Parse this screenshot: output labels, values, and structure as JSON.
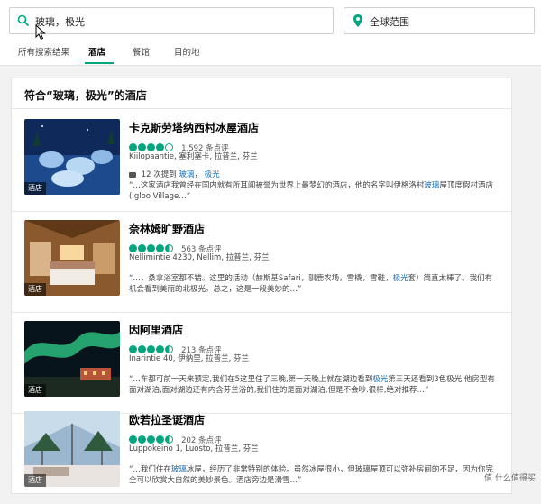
{
  "search": {
    "query": "玻璃，极光"
  },
  "location": {
    "value": "全球范围"
  },
  "tabs": [
    {
      "label": "所有搜索结果"
    },
    {
      "label": "酒店"
    },
    {
      "label": "餐馆"
    },
    {
      "label": "目的地"
    }
  ],
  "panel": {
    "title": "符合“玻璃，极光”的酒店"
  },
  "hotels": [
    {
      "name": "卡克斯劳塔纳西村冰屋酒店",
      "rating": 4.0,
      "reviews": "1,592 条点评",
      "address": "Kiilopaantie, 塞利塞卡, 拉普兰, 芬兰",
      "tag": "酒店",
      "mention_prefix": "12 次提到",
      "mention_kw1": "玻璃",
      "mention_sep": "，",
      "mention_kw2": "极光",
      "snippet_a": "“…这家酒店我曾经在国内就有所耳闻被誉为世界上最梦幻的酒店，他的名字叫伊格洛村",
      "snippet_hl": "玻璃",
      "snippet_b": "屋顶度假村酒店(Igloo Village…”"
    },
    {
      "name": "奈林姆旷野酒店",
      "rating": 4.5,
      "reviews": "563 条点评",
      "address": "Nellimintie 4230, Nellim, 拉普兰, 芬兰",
      "tag": "酒店",
      "snippet_a": "“…，桑拿浴室都不错。这里的活动（赫斯基Safari，驯鹿农场，雪橇，雪鞋，",
      "snippet_hl": "极光",
      "snippet_b": "套）简直太棒了。我们有机会看到美丽的北极光。总之，这是一段美妙的…”"
    },
    {
      "name": "因阿里酒店",
      "rating": 4.5,
      "reviews": "213 条点评",
      "address": "Inarintie 40, 伊纳里, 拉普兰, 芬兰",
      "tag": "酒店",
      "snippet_a": "“…车都可前一天来预定,我们在5这里住了三晚,第一天晚上就在湖边看到",
      "snippet_hl": "极光",
      "snippet_b": "第三天还看到3色极光,他房型有面对湖泊,面对湖边还有内含芬兰浴的,我们住的是面对湖泊,但是不会吵.很棒,绝对推荐…”"
    },
    {
      "name": "欧若拉圣诞酒店",
      "rating": 4.5,
      "reviews": "202 条点评",
      "address": "Luppokeino 1, Luosto, 拉普兰, 芬兰",
      "tag": "酒店",
      "snippet_a": "“…我们住在",
      "snippet_hl": "玻璃",
      "snippet_b": "冰屋，经历了非常特别的体验。虽然冰屋很小，但玻璃屋顶可以弥补房间的不足，因为你完全可以欣赏大自然的美妙景色。酒店旁边是滑雪…”"
    }
  ],
  "watermark": "值 什么值得买",
  "colors": {
    "accent": "#00a680",
    "link": "#1a6fb8"
  }
}
